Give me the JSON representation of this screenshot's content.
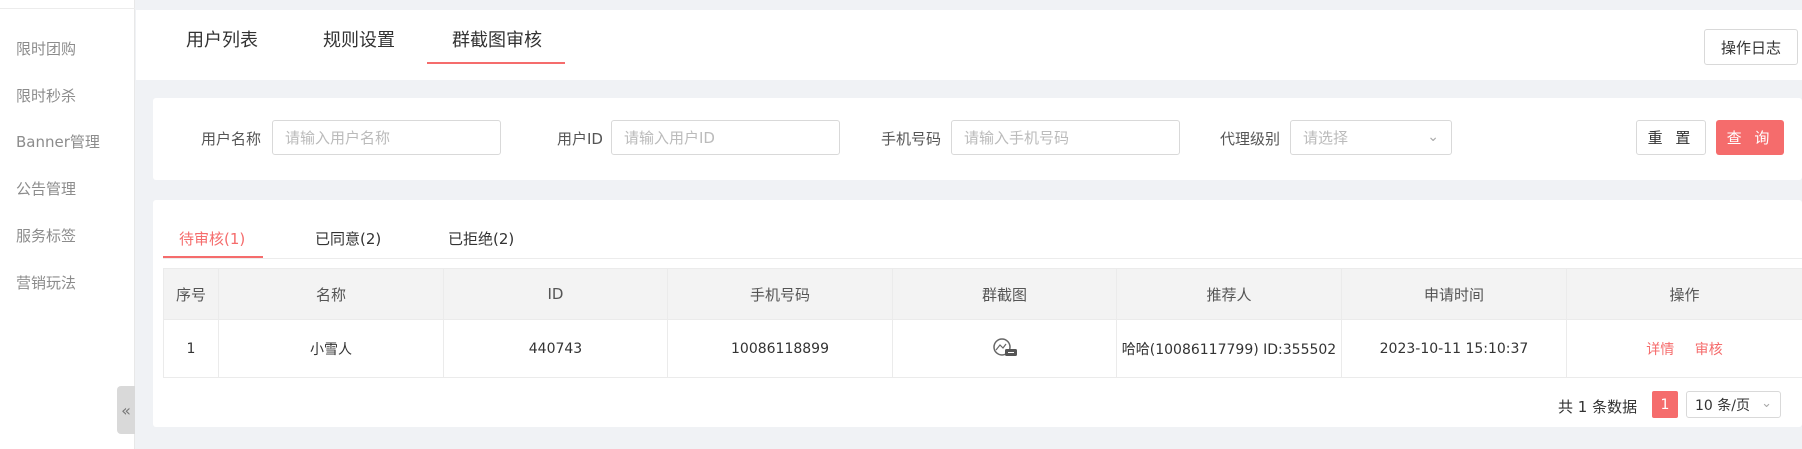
{
  "sidebar": {
    "items": [
      {
        "label": "限时团购"
      },
      {
        "label": "限时秒杀"
      },
      {
        "label": "Banner管理"
      },
      {
        "label": "公告管理"
      },
      {
        "label": "服务标签"
      },
      {
        "label": "营销玩法"
      }
    ],
    "collapse_icon": "«"
  },
  "top_tabs": [
    {
      "label": "用户列表"
    },
    {
      "label": "规则设置"
    },
    {
      "label": "群截图审核"
    }
  ],
  "log_button": "操作日志",
  "filters": {
    "user_name": {
      "label": "用户名称",
      "placeholder": "请输入用户名称"
    },
    "user_id": {
      "label": "用户ID",
      "placeholder": "请输入用户ID"
    },
    "phone": {
      "label": "手机号码",
      "placeholder": "请输入手机号码"
    },
    "agent_level": {
      "label": "代理级别",
      "placeholder": "请选择"
    },
    "reset": "重 置",
    "query": "查 询"
  },
  "sub_tabs": [
    {
      "label": "待审核(1)"
    },
    {
      "label": "已同意(2)"
    },
    {
      "label": "已拒绝(2)"
    }
  ],
  "table": {
    "headers": [
      "序号",
      "名称",
      "ID",
      "手机号码",
      "群截图",
      "推荐人",
      "申请时间",
      "操作"
    ],
    "rows": [
      {
        "index": "1",
        "name": "小雪人",
        "id": "440743",
        "phone": "10086118899",
        "screenshot_icon": "image-thumbnail-icon",
        "referrer": "哈哈(10086117799) ID:355502",
        "time": "2023-10-11 15:10:37",
        "actions": [
          "详情",
          "审核"
        ]
      }
    ]
  },
  "pagination": {
    "total": "共 1 条数据",
    "current_page": "1",
    "page_size": "10 条/页"
  },
  "colors": {
    "accent": "#f56c6c"
  }
}
